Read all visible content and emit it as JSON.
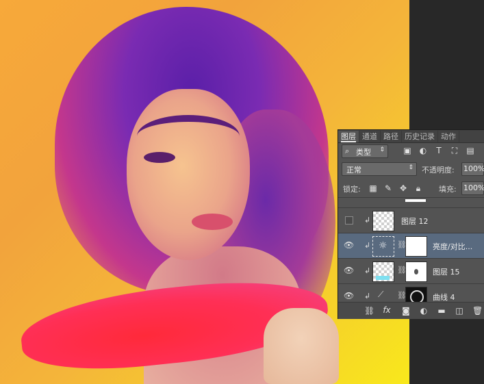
{
  "panel": {
    "tabs": [
      {
        "label": "图层",
        "active": true
      },
      {
        "label": "通道",
        "active": false
      },
      {
        "label": "路径",
        "active": false
      },
      {
        "label": "历史记录",
        "active": false
      },
      {
        "label": "动作",
        "active": false
      }
    ],
    "filter": {
      "label": "类型"
    },
    "blend_mode": "正常",
    "opacity_label": "不透明度:",
    "opacity_value": "100%",
    "lock_label": "锁定:",
    "fill_label": "填充:",
    "fill_value": "100%",
    "layers": [
      {
        "name": "图层 12",
        "visible": false,
        "thumb": "checker",
        "mask": false
      },
      {
        "name": "亮度/对比...",
        "visible": true,
        "thumb": "adjustment",
        "mask": true,
        "selected": true
      },
      {
        "name": "图层 15",
        "visible": true,
        "thumb": "checker",
        "mask": true
      },
      {
        "name": "曲线 4",
        "visible": true,
        "thumb": "curves",
        "mask": true
      }
    ],
    "footer_icons": [
      "link-icon",
      "fx-icon",
      "mask-icon",
      "adjustment-icon",
      "folder-icon",
      "new-layer-icon",
      "trash-icon"
    ]
  }
}
